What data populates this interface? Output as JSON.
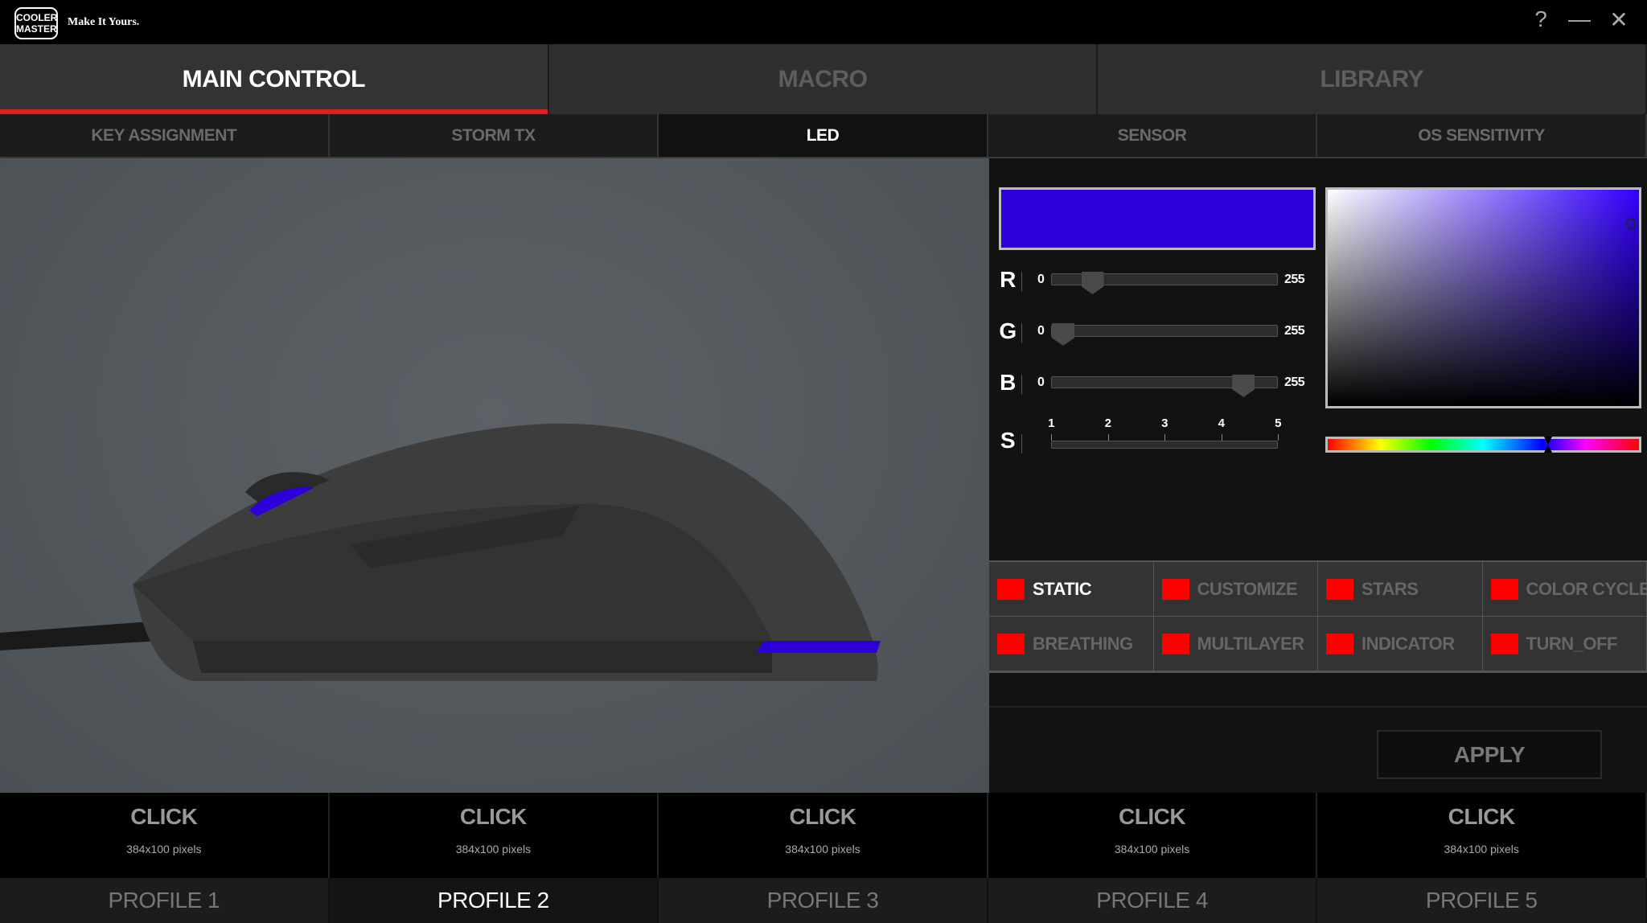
{
  "app": {
    "logo_text": "COOLER MASTER",
    "tagline": "Make It Yours.",
    "window_buttons": [
      "help-icon",
      "minimize-icon",
      "close-icon"
    ],
    "help": "?",
    "minimize": "—",
    "close": "✕"
  },
  "main_tabs": [
    {
      "label": "MAIN CONTROL",
      "active": true
    },
    {
      "label": "MACRO",
      "active": false
    },
    {
      "label": "LIBRARY",
      "active": false
    }
  ],
  "sub_tabs": [
    {
      "label": "KEY ASSIGNMENT"
    },
    {
      "label": "STORM TX"
    },
    {
      "label": "LED",
      "active": true
    },
    {
      "label": "SENSOR"
    },
    {
      "label": "OS SENSITIVITY"
    }
  ],
  "led": {
    "current_color": "#2e00d9",
    "sliders": {
      "r": {
        "label": "R",
        "min": "0",
        "max": "255",
        "value": 46
      },
      "g": {
        "label": "G",
        "min": "0",
        "max": "255",
        "value": 0
      },
      "b": {
        "label": "B",
        "min": "0",
        "max": "255",
        "value": 217
      }
    },
    "speed": {
      "label": "S",
      "ticks": [
        "1",
        "2",
        "3",
        "4",
        "5"
      ]
    },
    "effects": [
      {
        "label": "STATIC",
        "active": true
      },
      {
        "label": "CUSTOMIZE"
      },
      {
        "label": "STARS"
      },
      {
        "label": "COLOR CYCLE"
      },
      {
        "label": "BREATHING"
      },
      {
        "label": "MULTILAYER"
      },
      {
        "label": "INDICATOR"
      },
      {
        "label": "TURN_OFF"
      }
    ],
    "swatch_color": "#ff0000",
    "apply_label": "APPLY"
  },
  "bottom": {
    "buttons": [
      {
        "title": "CLICK",
        "sub": "384x100 pixels"
      },
      {
        "title": "CLICK",
        "sub": "384x100 pixels"
      },
      {
        "title": "CLICK",
        "sub": "384x100 pixels"
      },
      {
        "title": "CLICK",
        "sub": "384x100 pixels"
      },
      {
        "title": "CLICK",
        "sub": "384x100 pixels"
      }
    ],
    "profiles": [
      {
        "label": "PROFILE 1"
      },
      {
        "label": "PROFILE 2",
        "active": true
      },
      {
        "label": "PROFILE 3"
      },
      {
        "label": "PROFILE 4"
      },
      {
        "label": "PROFILE 5"
      }
    ]
  }
}
